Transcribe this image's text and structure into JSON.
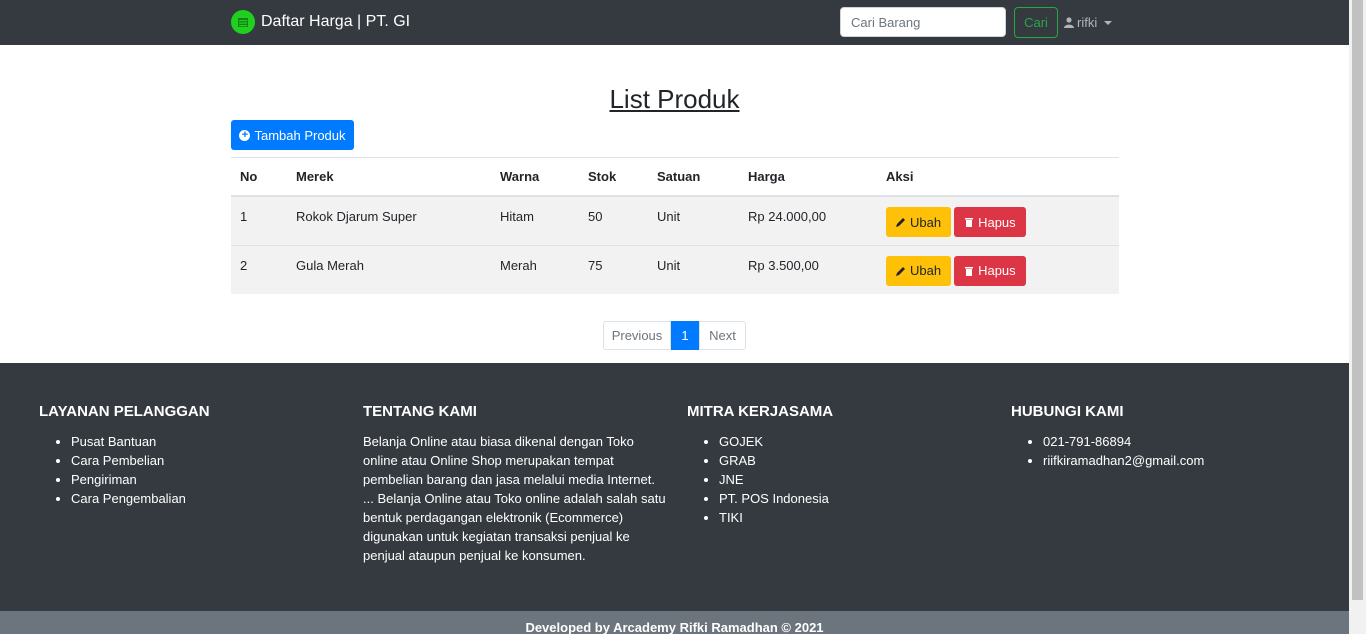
{
  "navbar": {
    "brand": "Daftar Harga | PT. GI",
    "search_placeholder": "Cari Barang",
    "search_button": "Cari",
    "user": "rifki"
  },
  "main": {
    "title": "List Produk",
    "add_button": "Tambah Produk",
    "table": {
      "headers": [
        "No",
        "Merek",
        "Warna",
        "Stok",
        "Satuan",
        "Harga",
        "Aksi"
      ],
      "rows": [
        {
          "no": "1",
          "merek": "Rokok Djarum Super",
          "warna": "Hitam",
          "stok": "50",
          "satuan": "Unit",
          "harga": "Rp 24.000,00"
        },
        {
          "no": "2",
          "merek": "Gula Merah",
          "warna": "Merah",
          "stok": "75",
          "satuan": "Unit",
          "harga": "Rp 3.500,00"
        }
      ],
      "edit_label": "Ubah",
      "delete_label": "Hapus"
    },
    "pagination": {
      "previous": "Previous",
      "current": "1",
      "next": "Next"
    }
  },
  "footer": {
    "layanan": {
      "title": "LAYANAN PELANGGAN",
      "items": [
        "Pusat Bantuan",
        "Cara Pembelian",
        "Pengiriman",
        "Cara Pengembalian"
      ]
    },
    "tentang": {
      "title": "TENTANG KAMI",
      "text": "Belanja Online atau biasa dikenal dengan Toko online atau Online Shop merupakan tempat pembelian barang dan jasa melalui media Internet. ... Belanja Online atau Toko online adalah salah satu bentuk perdagangan elektronik (Ecommerce) digunakan untuk kegiatan transaksi penjual ke penjual ataupun penjual ke konsumen."
    },
    "mitra": {
      "title": "MITRA KERJASAMA",
      "items": [
        "GOJEK",
        "GRAB",
        "JNE",
        "PT. POS Indonesia",
        "TIKI"
      ]
    },
    "hubungi": {
      "title": "HUBUNGI KAMI",
      "items": [
        "021-791-86894",
        "riifkiramadhan2@gmail.com"
      ]
    },
    "credit": "Developed by Arcademy Rifki Ramadhan © 2021"
  },
  "colors": {
    "navbar": "#343a40",
    "primary": "#007bff",
    "warning": "#ffc107",
    "danger": "#dc3545",
    "success": "#28a745",
    "footer_bottom": "#6c757d"
  }
}
